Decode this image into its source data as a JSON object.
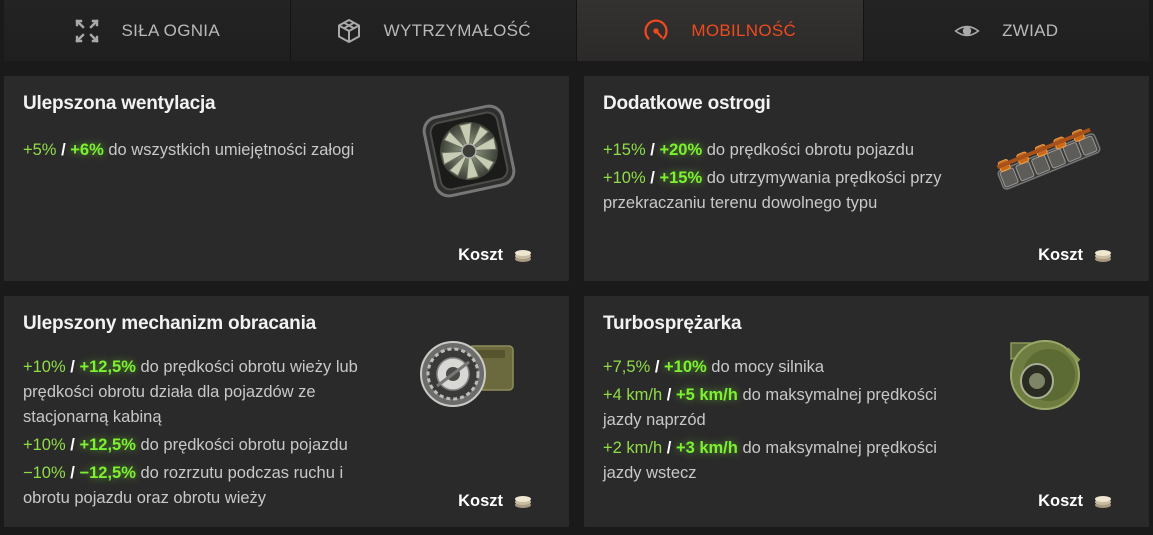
{
  "tabs": [
    {
      "label": "SIŁA OGNIA",
      "icon": "crosshair-arrows-icon",
      "active": false
    },
    {
      "label": "WYTRZYMAŁOŚĆ",
      "icon": "armor-cube-icon",
      "active": false
    },
    {
      "label": "MOBILNOŚĆ",
      "icon": "speedometer-icon",
      "active": true
    },
    {
      "label": "ZWIAD",
      "icon": "eye-icon",
      "active": false
    }
  ],
  "colors": {
    "accent_active": "#f0491e",
    "value_base": "#8fdc47",
    "value_bonus": "#7cf22f",
    "card_bg": "#2b2a2b",
    "page_bg": "#1b1a1a"
  },
  "cards": [
    {
      "title": "Ulepszona wentylacja",
      "image_icon": "ventilation-fan-icon",
      "effects": [
        {
          "v1": "+5%",
          "v2": "+6%",
          "text": "do wszystkich umiejętności załogi"
        }
      ],
      "cost_label": "Koszt",
      "cost_icon": "credits-coin-icon"
    },
    {
      "title": "Dodatkowe ostrogi",
      "image_icon": "track-grousers-icon",
      "effects": [
        {
          "v1": "+15%",
          "v2": "+20%",
          "text": "do prędkości obrotu pojazdu"
        },
        {
          "v1": "+10%",
          "v2": "+15%",
          "text": "do utrzymywania prędkości przy przekraczaniu terenu dowolnego typu"
        }
      ],
      "cost_label": "Koszt",
      "cost_icon": "credits-coin-icon"
    },
    {
      "title": "Ulepszony mechanizm obracania",
      "image_icon": "turret-traverse-gear-icon",
      "effects": [
        {
          "v1": "+10%",
          "v2": "+12,5%",
          "text": "do prędkości obrotu wieży lub prędkości obrotu działa dla pojazdów ze stacjonarną kabiną"
        },
        {
          "v1": "+10%",
          "v2": "+12,5%",
          "text": "do prędkości obrotu pojazdu"
        },
        {
          "v1": "−10%",
          "v2": "−12,5%",
          "text": "do rozrzutu podczas ruchu i obrotu pojazdu oraz obrotu wieży"
        }
      ],
      "cost_label": "Koszt",
      "cost_icon": "credits-coin-icon"
    },
    {
      "title": "Turbosprężarka",
      "image_icon": "turbocharger-icon",
      "effects": [
        {
          "v1": "+7,5%",
          "v2": "+10%",
          "text": "do mocy silnika"
        },
        {
          "v1": "+4 km/h",
          "v2": "+5 km/h",
          "text": "do maksymalnej prędkości jazdy naprzód"
        },
        {
          "v1": "+2 km/h",
          "v2": "+3 km/h",
          "text": "do maksymalnej prędkości jazdy wstecz"
        }
      ],
      "cost_label": "Koszt",
      "cost_icon": "credits-coin-icon"
    }
  ]
}
